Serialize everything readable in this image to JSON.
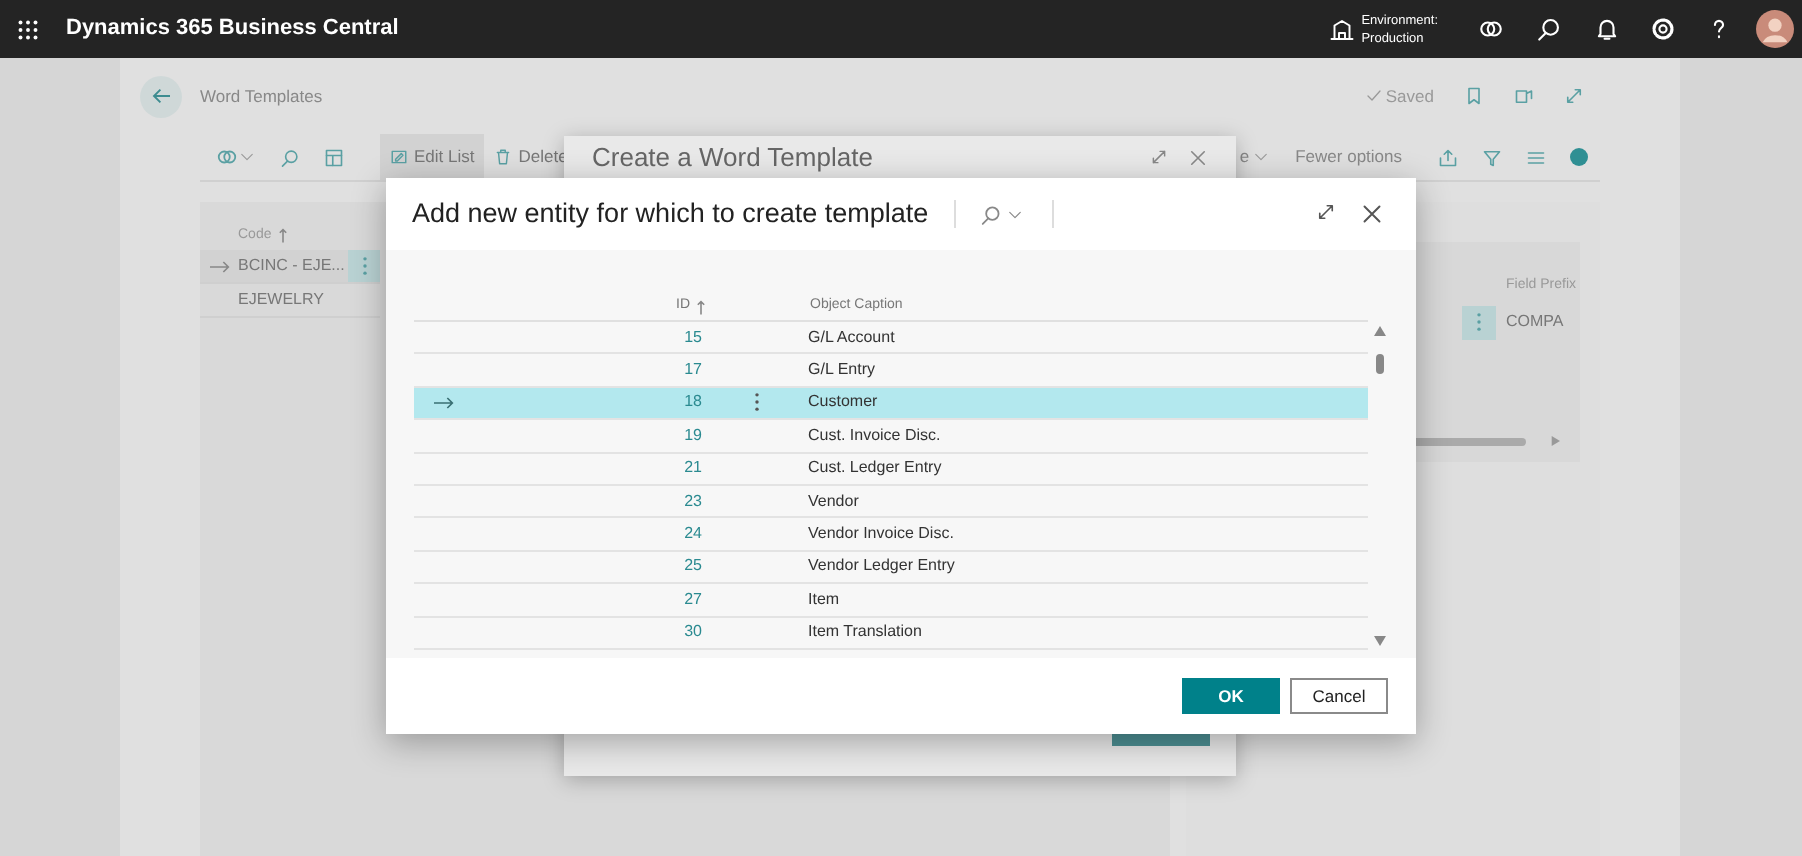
{
  "app": {
    "title": "Dynamics 365 Business Central",
    "environment_label": "Environment:",
    "environment_value": "Production"
  },
  "page": {
    "title": "Word Templates",
    "save_status": "Saved",
    "toolbar": {
      "actions": [
        {
          "label": "Edit List",
          "selected": true
        },
        {
          "label": "Delete",
          "selected": false
        }
      ],
      "partial_action": "e",
      "fewer_options": "Fewer options"
    },
    "list": {
      "column": "Code",
      "rows": [
        {
          "code": "BCINC - EJE...",
          "selected": true
        },
        {
          "code": "EJEWELRY",
          "selected": false
        }
      ]
    },
    "details": {
      "column": "Field Prefix",
      "value": "COMPA"
    }
  },
  "back_dialog": {
    "title": "Create a Word Template"
  },
  "dialog": {
    "title": "Add new entity for which to create template",
    "columns": [
      "ID",
      "Object Caption"
    ],
    "rows": [
      {
        "id": "15",
        "caption": "G/L Account",
        "selected": false
      },
      {
        "id": "17",
        "caption": "G/L Entry",
        "selected": false
      },
      {
        "id": "18",
        "caption": "Customer",
        "selected": true
      },
      {
        "id": "19",
        "caption": "Cust. Invoice Disc.",
        "selected": false
      },
      {
        "id": "21",
        "caption": "Cust. Ledger Entry",
        "selected": false
      },
      {
        "id": "23",
        "caption": "Vendor",
        "selected": false
      },
      {
        "id": "24",
        "caption": "Vendor Invoice Disc.",
        "selected": false
      },
      {
        "id": "25",
        "caption": "Vendor Ledger Entry",
        "selected": false
      },
      {
        "id": "27",
        "caption": "Item",
        "selected": false
      },
      {
        "id": "30",
        "caption": "Item Translation",
        "selected": false
      }
    ],
    "buttons": [
      {
        "label": "OK",
        "kind": "primary"
      },
      {
        "label": "Cancel",
        "kind": "secondary"
      }
    ]
  }
}
